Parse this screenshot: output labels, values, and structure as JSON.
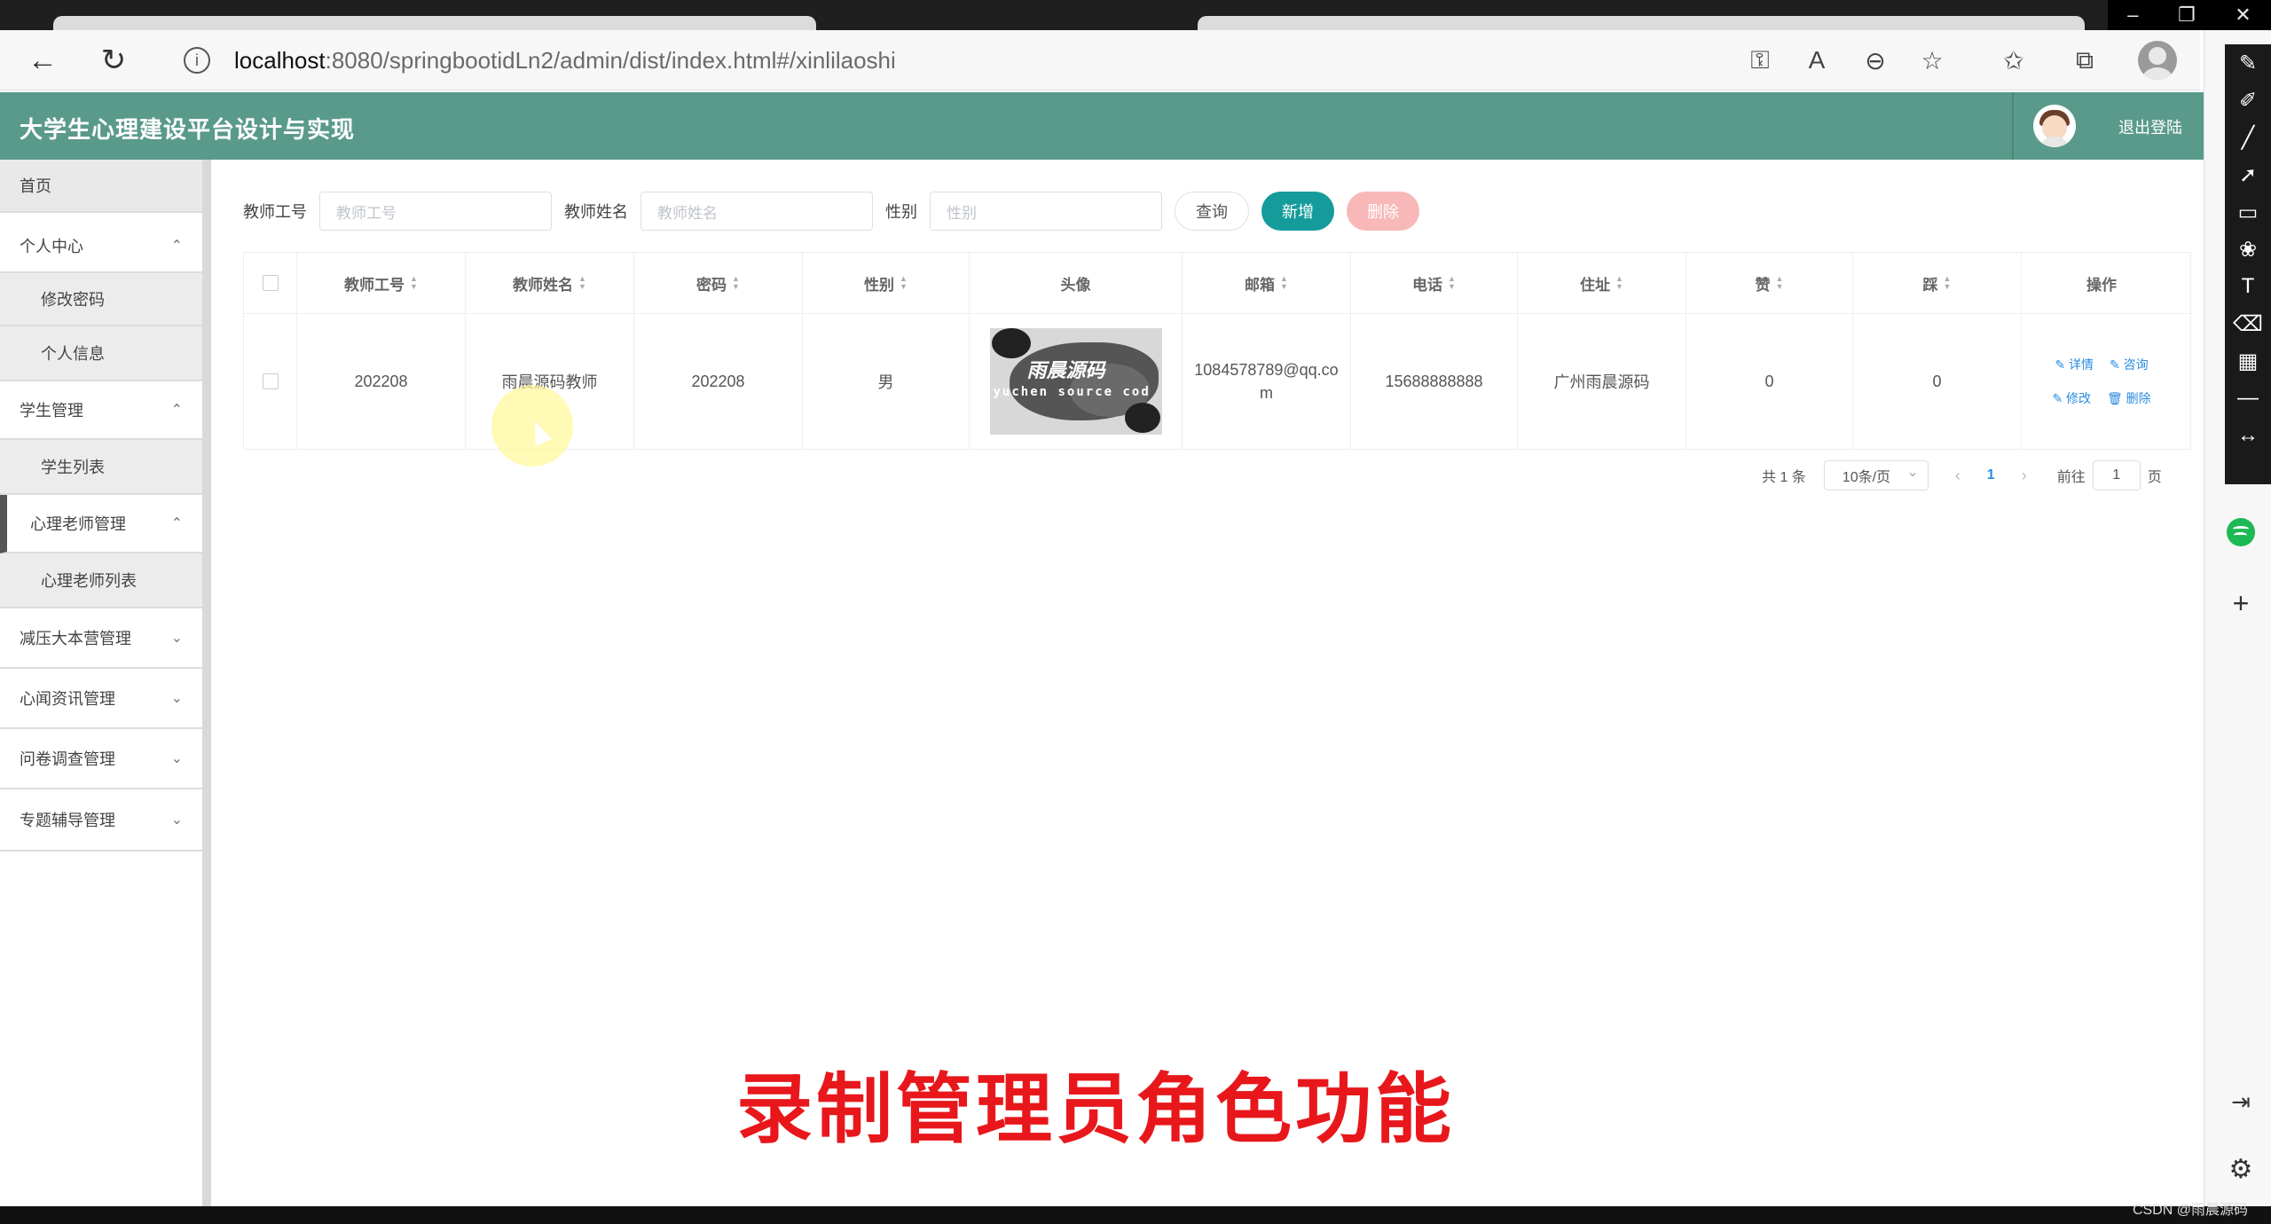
{
  "browser": {
    "url_host": "localhost",
    "url_path": ":8080/springbootidLn2/admin/dist/index.html#/xinlilaoshi"
  },
  "header": {
    "title": "大学生心理建设平台设计与实现",
    "logout": "退出登陆"
  },
  "sidebar": {
    "items": [
      {
        "label": "首页"
      },
      {
        "label": "个人中心"
      },
      {
        "label": "修改密码"
      },
      {
        "label": "个人信息"
      },
      {
        "label": "学生管理"
      },
      {
        "label": "学生列表"
      },
      {
        "label": "心理老师管理"
      },
      {
        "label": "心理老师列表"
      },
      {
        "label": "减压大本营管理"
      },
      {
        "label": "心闻资讯管理"
      },
      {
        "label": "问卷调查管理"
      },
      {
        "label": "专题辅导管理"
      }
    ]
  },
  "search": {
    "teacher_id_label": "教师工号",
    "teacher_id_placeholder": "教师工号",
    "teacher_name_label": "教师姓名",
    "teacher_name_placeholder": "教师姓名",
    "gender_label": "性别",
    "gender_placeholder": "性别",
    "query_btn": "查询",
    "add_btn": "新增",
    "delete_btn": "删除"
  },
  "table": {
    "columns": [
      "教师工号",
      "教师姓名",
      "密码",
      "性别",
      "头像",
      "邮箱",
      "电话",
      "住址",
      "赞",
      "踩",
      "操作"
    ],
    "rows": [
      {
        "id": "202208",
        "name": "雨晨源码教师",
        "password": "202208",
        "gender": "男",
        "avatar_text1": "雨晨源码",
        "avatar_text2": "yuchen source cod",
        "email": "1084578789@qq.com",
        "phone": "15688888888",
        "address": "广州雨晨源码",
        "likes": "0",
        "dislikes": "0",
        "op_detail": "详情",
        "op_consult": "咨询",
        "op_edit": "修改",
        "op_delete": "删除"
      }
    ]
  },
  "pagination": {
    "total": "共 1 条",
    "page_size": "10条/页",
    "current": "1",
    "goto_label": "前往",
    "goto_value": "1",
    "page_suffix": "页"
  },
  "caption": "录制管理员角色功能",
  "watermark": "CSDN @雨晨源码"
}
